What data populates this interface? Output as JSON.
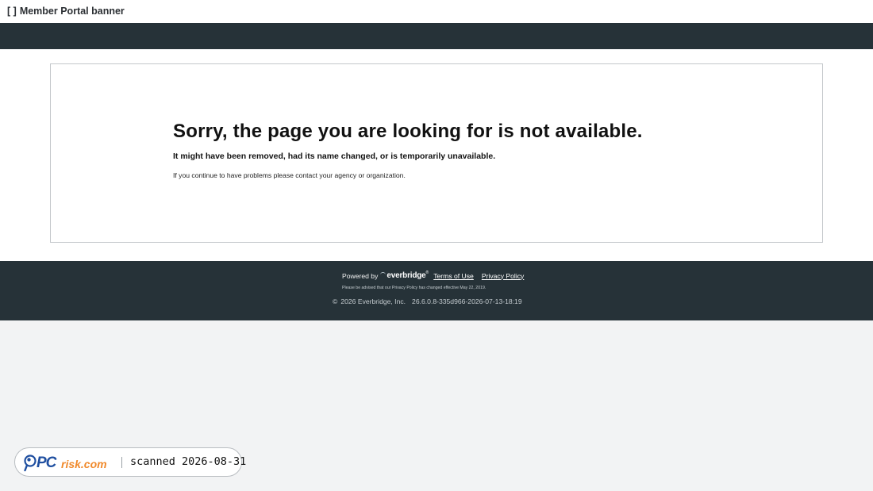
{
  "banner": {
    "bracket": "[ ]",
    "title": "Member Portal banner"
  },
  "error": {
    "title": "Sorry, the page you are looking for is not available.",
    "subtitle": "It might have been removed, had its name changed, or is temporarily unavailable.",
    "note": "If you continue to have problems please contact your agency or organization."
  },
  "footer": {
    "powered_by": "Powered by",
    "logo_text": "everbridge",
    "logo_tm": "®",
    "terms_link": "Terms of Use",
    "privacy_link": "Privacy Policy",
    "privacy_notice": "Please be advised that our Privacy Policy has changed effective May 22, 2019.",
    "copyright_symbol": "©",
    "copyright": "2026 Everbridge, Inc.",
    "version": "26.6.0.8-335d966-2026-07-13-18:19"
  },
  "scan_badge": {
    "logo_text": "PCrisk.com",
    "scan_text": "scanned 2026-08-31"
  },
  "colors": {
    "nav_bar": "#263238",
    "footer": "#263238",
    "page_background": "#f2f3f4",
    "pcrisk_blue": "#1f4fa0",
    "pcrisk_orange": "#f0892a"
  },
  "icons": {
    "everbridge_logo": "everbridge-logo-icon",
    "pcrisk_logo": "pcrisk-logo-icon"
  }
}
